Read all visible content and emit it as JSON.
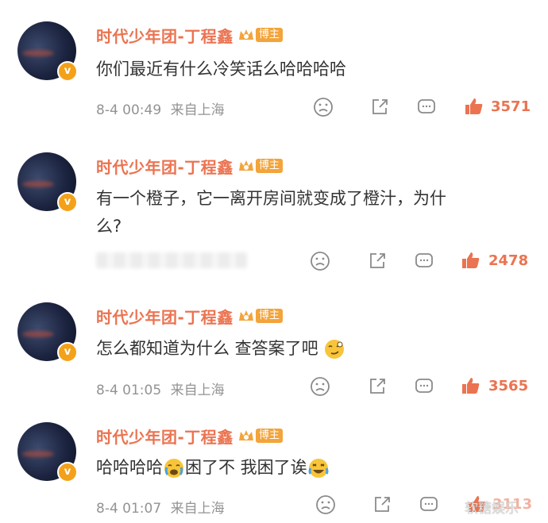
{
  "comments": [
    {
      "username": "时代少年团-丁程鑫",
      "badge": "博主",
      "text": "你们最近有什么冷笑话么哈哈哈哈",
      "time": "8-4 00:49",
      "location": "来自上海",
      "likes": "3571"
    },
    {
      "username": "时代少年团-丁程鑫",
      "badge": "博主",
      "text": "有一个橙子，它一离开房间就变成了橙汁，为什么？",
      "text_line1": "有一个橙子，它一离开房间就变成了橙汁，为什",
      "text_line2": "么?",
      "time": "",
      "location": "",
      "likes": "2478"
    },
    {
      "username": "时代少年团-丁程鑫",
      "badge": "博主",
      "text": "怎么都知道为什么 查答案了吧",
      "time": "8-4 01:05",
      "location": "来自上海",
      "likes": "3565"
    },
    {
      "username": "时代少年团-丁程鑫",
      "badge": "博主",
      "text_part1": "哈哈哈哈",
      "text_part2": "困了不 我困了诶",
      "time": "8-4 01:07",
      "location": "来自上海",
      "likes": "3113"
    }
  ],
  "watermark": "软糖娱乐",
  "colors": {
    "username": "#eb7350",
    "like": "#eb7350",
    "meta": "#939393",
    "text": "#333333",
    "badge": "#f3a43a"
  },
  "icons": [
    "sad-face-icon",
    "share-icon",
    "comment-icon",
    "thumbs-up-icon",
    "verified-badge-icon",
    "crown-icon",
    "emoji-smirk-icon",
    "emoji-crying-icon",
    "emoji-laughing-icon"
  ]
}
